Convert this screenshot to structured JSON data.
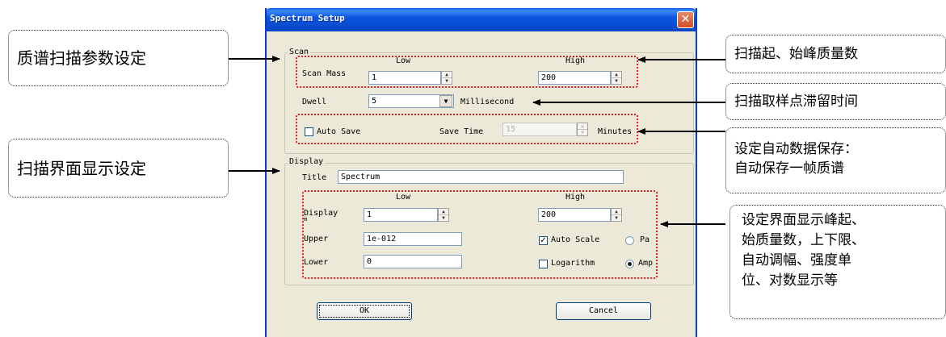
{
  "callouts": {
    "left_top": "质谱扫描参数设定",
    "left_bottom": "扫描界面显示设定",
    "right_1": "扫描起、始峰质量数",
    "right_2": "扫描取样点滞留时间",
    "right_3_line1": "设定自动数据保存：",
    "right_3_line2": "自动保存一帧质谱",
    "right_4_lines": [
      "设定界面显示峰起、",
      "始质量数，上下限、",
      "自动调幅、强度单",
      "位、对数显示等"
    ]
  },
  "dialog": {
    "title": "Spectrum Setup",
    "close": "✕",
    "scan": {
      "group_label": "Scan",
      "low_header": "Low",
      "high_header": "High",
      "scan_mass_label": "Scan Mass",
      "scan_mass_low": "1",
      "scan_mass_high": "200",
      "dwell_label": "Dwell",
      "dwell_value": "5",
      "dwell_unit": "Millisecond",
      "auto_save_label": "Auto Save",
      "auto_save_checked": false,
      "save_time_label": "Save Time",
      "save_time_value": "15",
      "save_time_unit": "Minutes"
    },
    "display": {
      "group_label": "Display",
      "title_label": "Title",
      "title_value": "Spectrum",
      "low_header": "Low",
      "high_header": "High",
      "display_label": "Display",
      "display_label_sub": "m",
      "display_low": "1",
      "display_high": "200",
      "upper_label": "Upper",
      "upper_value": "1e-012",
      "lower_label": "Lower",
      "lower_value": "0",
      "auto_scale_label": "Auto Scale",
      "auto_scale_checked": true,
      "logarithm_label": "Logarithm",
      "logarithm_checked": false,
      "unit_pa_label": "Pa",
      "unit_amp_label": "Amp",
      "selected_unit": "Amp"
    },
    "ok_label": "OK",
    "cancel_label": "Cancel"
  },
  "colors": {
    "highlight_border": "#e02020",
    "titlebar": "#0a56e0",
    "dialog_bg": "#ece9d8"
  }
}
